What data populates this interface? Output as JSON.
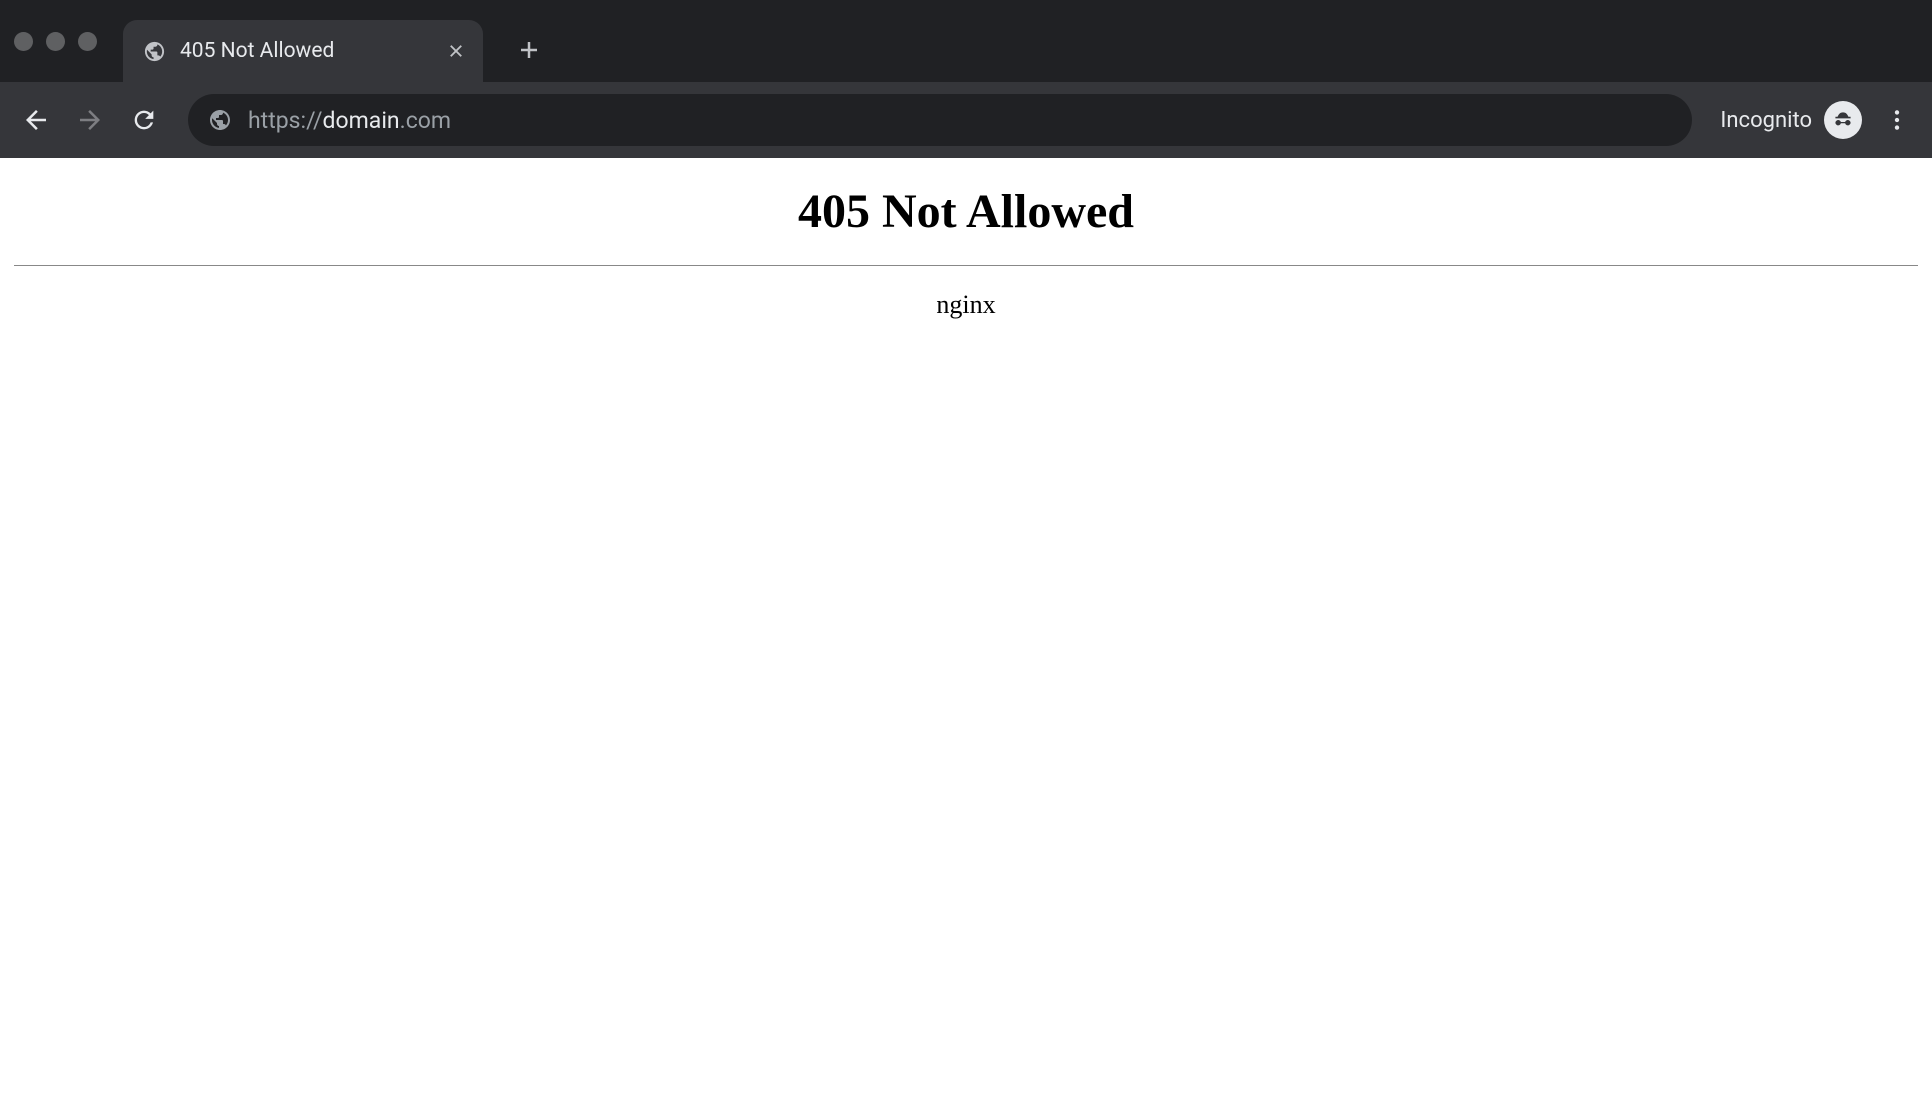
{
  "browser": {
    "tab": {
      "title": "405 Not Allowed",
      "favicon": "globe-icon"
    },
    "url": {
      "protocol": "https://",
      "host": "domain",
      "tld": ".com"
    },
    "incognito_label": "Incognito"
  },
  "page": {
    "heading": "405 Not Allowed",
    "server": "nginx"
  }
}
